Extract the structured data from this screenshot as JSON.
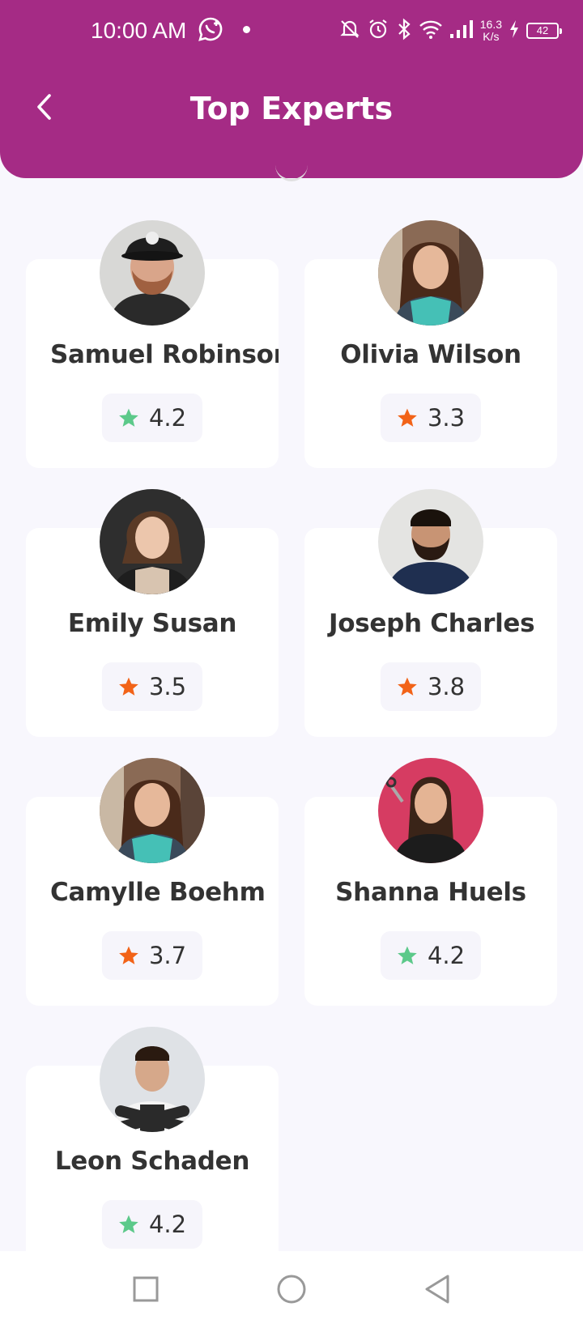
{
  "status_bar": {
    "time": "10:00 AM",
    "net_speed_value": "16.3",
    "net_speed_unit": "K/s",
    "battery": "42",
    "icons": [
      "whatsapp-icon",
      "dot-icon",
      "mute-bell-icon",
      "alarm-icon",
      "bluetooth-icon",
      "wifi-icon",
      "signal-icon",
      "charging-icon",
      "battery-icon"
    ]
  },
  "header": {
    "title": "Top Experts",
    "back_icon": "chevron-left-icon",
    "color": "#a52b85"
  },
  "experts": [
    {
      "name": "Samuel Robinson",
      "rating": "4.2",
      "star_color": "#5cc98a",
      "avatar": "man-with-cap-photo"
    },
    {
      "name": "Olivia Wilson",
      "rating": "3.3",
      "star_color": "#f26318",
      "avatar": "woman-in-apron-photo"
    },
    {
      "name": "Emily Susan",
      "rating": "3.5",
      "star_color": "#f26318",
      "avatar": "woman-curly-hair-photo"
    },
    {
      "name": "Joseph Charles",
      "rating": "3.8",
      "star_color": "#f26318",
      "avatar": "man-beard-polo-photo"
    },
    {
      "name": "Camylle Boehm",
      "rating": "3.7",
      "star_color": "#f26318",
      "avatar": "woman-in-apron-photo"
    },
    {
      "name": "Shanna Huels",
      "rating": "4.2",
      "star_color": "#5cc98a",
      "avatar": "woman-with-scissors-photo"
    },
    {
      "name": "Leon Schaden",
      "rating": "4.2",
      "star_color": "#5cc98a",
      "avatar": "man-crossed-arms-photo"
    }
  ],
  "nav_bar": {
    "icons": [
      "recent-apps-icon",
      "home-icon",
      "back-triangle-icon"
    ]
  }
}
